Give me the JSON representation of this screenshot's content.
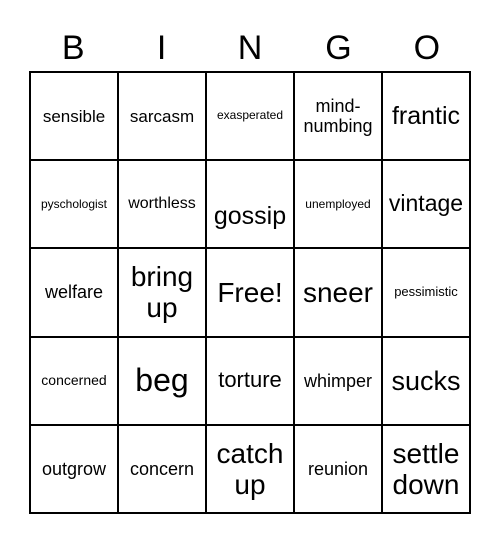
{
  "header": {
    "letters": [
      "B",
      "I",
      "N",
      "G",
      "O"
    ]
  },
  "grid": {
    "rows": [
      [
        "sensible",
        "sarcasm",
        "exasperated",
        "mind-\nnumbing",
        "frantic"
      ],
      [
        "pyschologist",
        "worthless",
        "gossip",
        "unemployed",
        "vintage"
      ],
      [
        "welfare",
        "bring\nup",
        "Free!",
        "sneer",
        "pessimistic"
      ],
      [
        "concerned",
        "beg",
        "torture",
        "whimper",
        "sucks"
      ],
      [
        "outgrow",
        "concern",
        "catch\nup",
        "reunion",
        "settle\ndown"
      ]
    ],
    "free_space": "Free!"
  }
}
